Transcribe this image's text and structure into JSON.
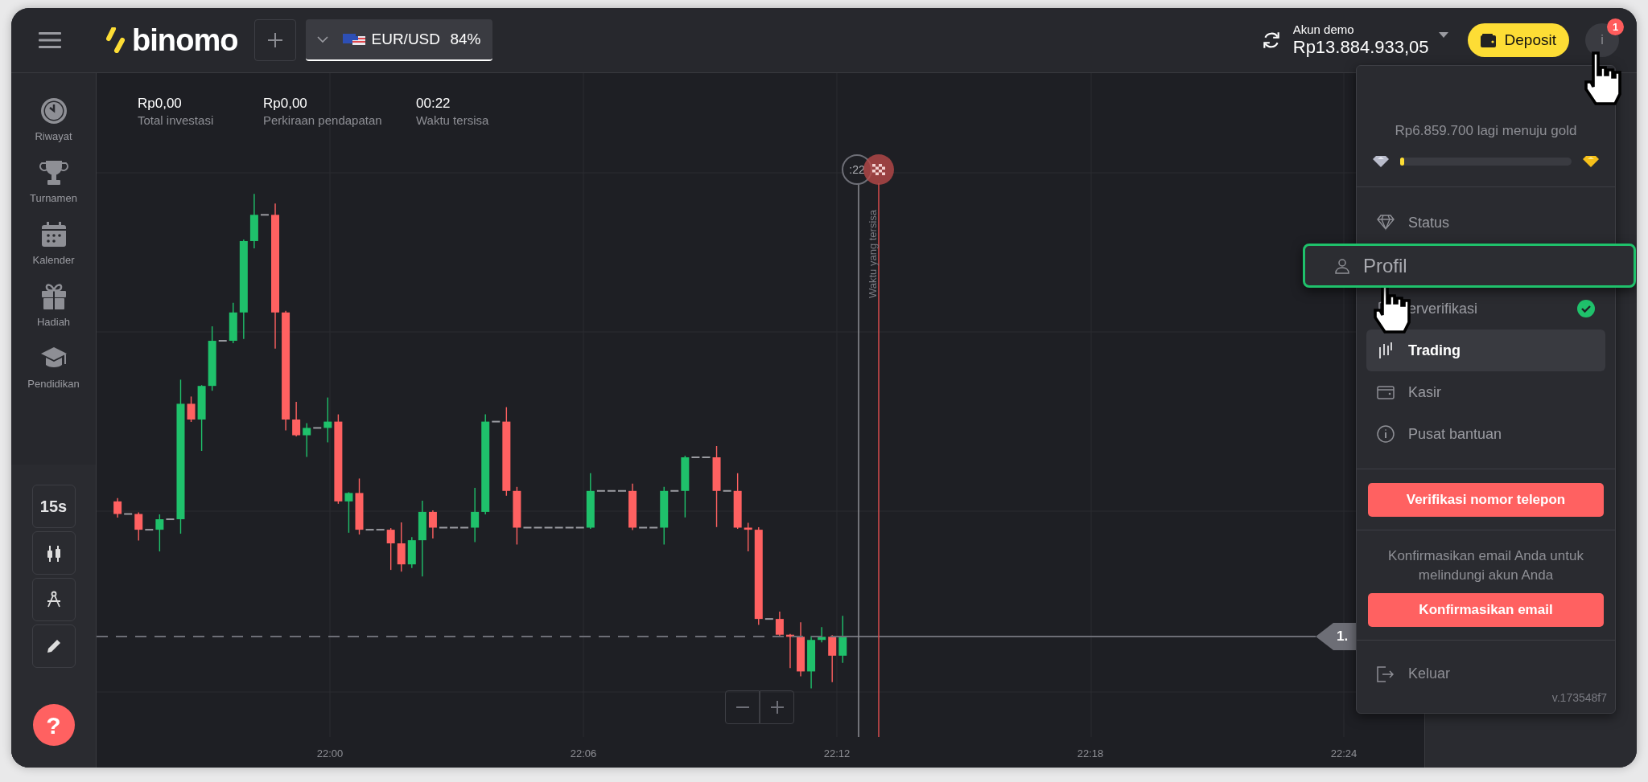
{
  "top_bar": {
    "logo": "binomo",
    "asset": {
      "name": "EUR/USD",
      "payout": "84%"
    },
    "account": {
      "label": "Akun demo",
      "balance": "Rp13.884.933,05"
    },
    "deposit": "Deposit",
    "avatar": {
      "letter": "i",
      "badge": "1"
    }
  },
  "sidebar": {
    "items": [
      {
        "label": "Riwayat"
      },
      {
        "label": "Turnamen"
      },
      {
        "label": "Kalender"
      },
      {
        "label": "Hadiah"
      },
      {
        "label": "Pendidikan"
      }
    ],
    "tools": [
      {
        "kind": "text",
        "label": "15s"
      },
      {
        "kind": "candles"
      },
      {
        "kind": "compass"
      },
      {
        "kind": "pencil"
      }
    ],
    "help": "?"
  },
  "stats": [
    {
      "value": "Rp0,00",
      "label": "Total investasi"
    },
    {
      "value": "Rp0,00",
      "label": "Perkiraan pendapatan"
    },
    {
      "value": "00:22",
      "label": "Waktu tersisa"
    }
  ],
  "chart": {
    "timer": ":22",
    "remaining_label": "Waktu yang tersisa",
    "price_tag": "1.",
    "time_labels": [
      "22:00",
      "22:06",
      "22:12",
      "22:18",
      "22:24"
    ]
  },
  "menu": {
    "progress": {
      "text": "Rp6.859.700 lagi menuju gold",
      "level": 0.02
    },
    "items": [
      {
        "label": "Status",
        "selected": false,
        "highlighted": false,
        "verified": false
      },
      {
        "label": "Profil",
        "selected": false,
        "highlighted": true,
        "verified": false
      },
      {
        "label": "erverifikasi",
        "selected": false,
        "highlighted": false,
        "verified": true
      },
      {
        "label": "Trading",
        "selected": true,
        "highlighted": false,
        "verified": false
      },
      {
        "label": "Kasir",
        "selected": false,
        "highlighted": false,
        "verified": false
      },
      {
        "label": "Pusat bantuan",
        "selected": false,
        "highlighted": false,
        "verified": false
      }
    ],
    "phone_button": "Verifikasi nomor telepon",
    "email_notice": "Konfirmasikan email Anda untuk melindungi akun Anda",
    "email_button": "Konfirmasikan email",
    "logout": "Keluar",
    "version": "v.173548f7"
  }
}
